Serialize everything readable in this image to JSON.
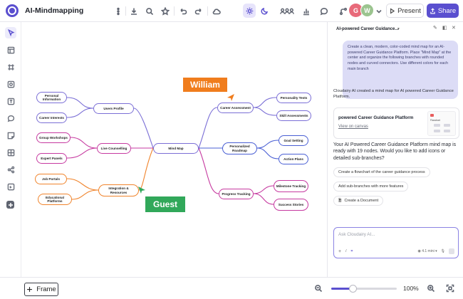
{
  "header": {
    "title": "AI-Mindmapping",
    "present_label": "Present",
    "share_label": "Share",
    "avatar1_letter": "G",
    "avatar2_letter": "W",
    "colors": {
      "accent": "#5a4fcf",
      "avatar1": "#e86a7a",
      "avatar2": "#9bc48f"
    }
  },
  "toolbar_icons": [
    "more-icon",
    "download-icon",
    "search-icon",
    "star-icon",
    "undo-icon",
    "redo-icon",
    "cloud-icon",
    "sun-icon",
    "moon-icon",
    "users-icon",
    "bar-chart-icon",
    "comment-icon",
    "connector-icon",
    "chevron-down-icon"
  ],
  "rail_icons": [
    "select-tool-icon",
    "layout-icon",
    "frame-tool-icon",
    "image-icon",
    "text-icon",
    "comment-icon",
    "sticky-note-icon",
    "grid-icon",
    "share-nodes-icon",
    "document-icon",
    "add-icon"
  ],
  "mindmap": {
    "root": "Mind Map",
    "branches": [
      {
        "label": "Users Profile",
        "color": "#7b6fd6",
        "children": [
          "Personal Information",
          "Career Interests"
        ]
      },
      {
        "label": "Live Counselling",
        "color": "#c63aa0",
        "children": [
          "Group Workshops",
          "Expert Panels"
        ]
      },
      {
        "label": "Integration & Resources",
        "color": "#f0842c",
        "children": [
          "Job Portals",
          "Educational Platforms"
        ]
      },
      {
        "label": "Career Assessment",
        "color": "#7b6fd6",
        "children": [
          "Personality Tests",
          "Skill Assessments"
        ]
      },
      {
        "label": "Personalized Roadmap",
        "color": "#4a5fd4",
        "children": [
          "Goal Setting",
          "Action Plans"
        ]
      },
      {
        "label": "Progress Tracking",
        "color": "#c63aa0",
        "children": [
          "Milestone Tracking",
          "Success Stories"
        ]
      }
    ]
  },
  "cursors": {
    "william": {
      "label": "William",
      "color": "#f07d1d"
    },
    "guest": {
      "label": "Guest",
      "color": "#31a85a"
    }
  },
  "bottom": {
    "frame_label": "Frame",
    "zoom_level": "100%",
    "zoom_slider_fraction": 0.33
  },
  "panel": {
    "title": "AI-powered Career Guidance...",
    "user_prompt": "Create a clean, modern, color-coded mind map for an AI-powered Career Guidance Platform. Place \"Mind Map\" at the center and organize the following branches with rounded nodes and curved connectors. Use different colors for each main branch",
    "reply": "Cloudairy AI created a mind map for AI powered Career Guidance Platform.",
    "card_title": "powered Career Guidance Platform",
    "card_link": "View on canvas",
    "card_thumb_label": "Flowchart",
    "summary": "Your AI Powered Career Guidance Platform mind map is ready with 19 nodes. Would you like to add icons or detailed sub-branches?",
    "suggestions": [
      "Create a flowchart of the career guidance process",
      "Add sub-branches with more features",
      "Create a Document"
    ],
    "input_placeholder": "Ask Cloudairy AI...",
    "model": "4.1 mini"
  }
}
